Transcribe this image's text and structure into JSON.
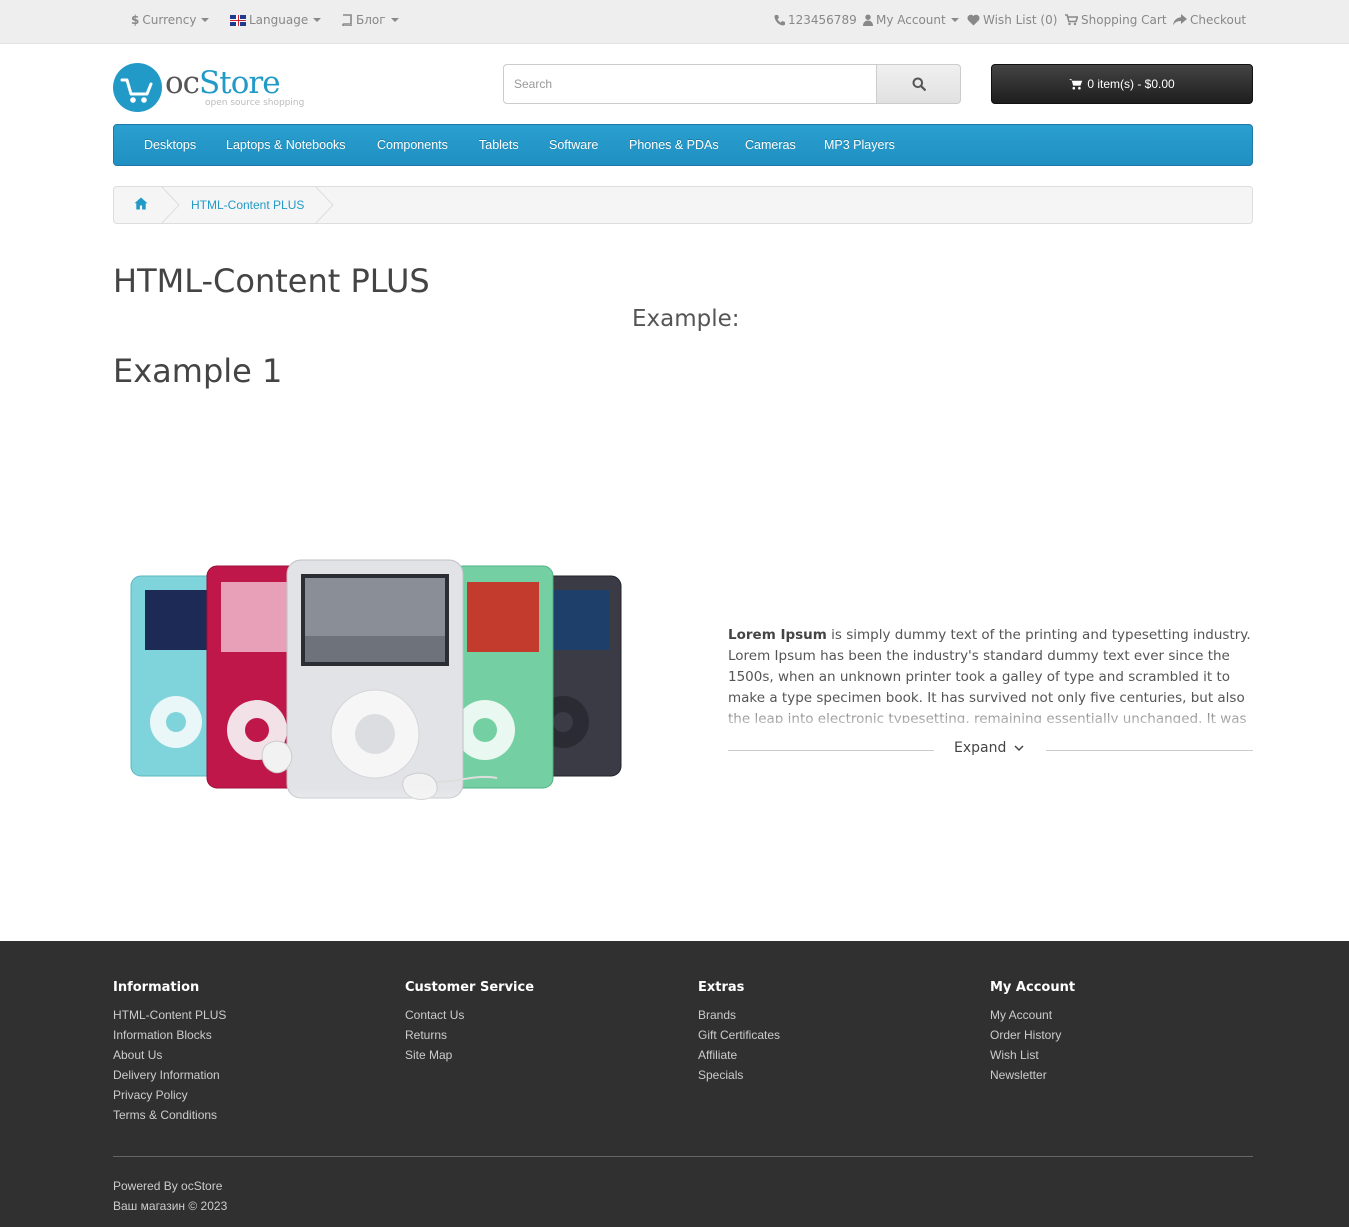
{
  "topbar": {
    "currency": "Currency",
    "language": "Language",
    "blog": "Блог",
    "phone": "123456789",
    "my_account": "My Account",
    "wish_list": "Wish List (0)",
    "shopping_cart": "Shopping Cart",
    "checkout": "Checkout"
  },
  "logo": {
    "part1": "oc",
    "part2": "Store",
    "tagline": "open source shopping"
  },
  "search": {
    "placeholder": "Search"
  },
  "cart": {
    "label": "0 item(s) - $0.00"
  },
  "menu": {
    "items": [
      "Desktops",
      "Laptops & Notebooks",
      "Components",
      "Tablets",
      "Software",
      "Phones & PDAs",
      "Cameras",
      "MP3 Players"
    ]
  },
  "breadcrumb": {
    "item": "HTML-Content PLUS"
  },
  "content": {
    "title": "HTML-Content PLUS",
    "example_label": "Example:",
    "example_heading": "Example 1",
    "lorem_bold": "Lorem Ipsum",
    "lorem_text": " is simply dummy text of the printing and typesetting industry. Lorem Ipsum has been the industry's standard dummy text ever since the 1500s, when an unknown printer took a galley of type and scrambled it to make a type specimen book. It has survived not only five centuries, but also the leap into electronic typesetting, remaining essentially unchanged. It was popularised",
    "expand": "Expand"
  },
  "footer": {
    "columns": [
      {
        "title": "Information",
        "links": [
          "HTML-Content PLUS",
          "Information Blocks",
          "About Us",
          "Delivery Information",
          "Privacy Policy",
          "Terms & Conditions"
        ]
      },
      {
        "title": "Customer Service",
        "links": [
          "Contact Us",
          "Returns",
          "Site Map"
        ]
      },
      {
        "title": "Extras",
        "links": [
          "Brands",
          "Gift Certificates",
          "Affiliate",
          "Specials"
        ]
      },
      {
        "title": "My Account",
        "links": [
          "My Account",
          "Order History",
          "Wish List",
          "Newsletter"
        ]
      }
    ],
    "powered": "Powered By ocStore",
    "copyright": "Ваш магазин © 2023"
  },
  "colors": {
    "accent": "#229ac8",
    "footer_bg": "#303030",
    "topbar_bg": "#eeeeee"
  }
}
